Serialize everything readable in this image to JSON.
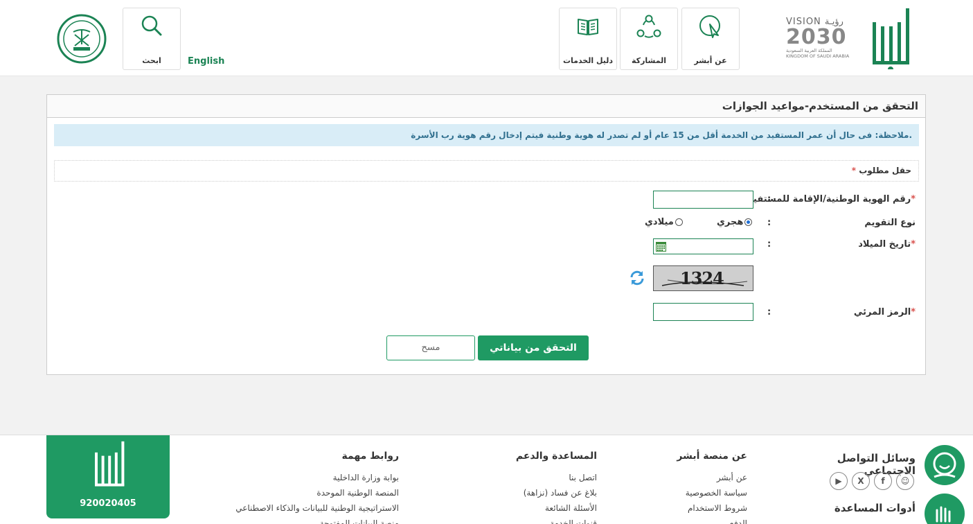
{
  "header": {
    "vision_text": "VISION",
    "vision_arabic": "رؤيـة",
    "vision_year": "2030",
    "kingdom_ar": "المملكة العربية السعودية",
    "kingdom_en": "KINGDOM OF SAUDI ARABIA",
    "tiles": [
      {
        "label": "عن أبشر",
        "icon": "cursor-icon"
      },
      {
        "label": "المشاركة",
        "icon": "share-icon"
      },
      {
        "label": "دليل الخدمات",
        "icon": "book-icon"
      }
    ],
    "search_label": "ابحث",
    "language_link": "English",
    "accent": "#1b8354"
  },
  "form": {
    "title": "التحقق من المستخدم-مواعيد الجوازات",
    "note": "ملاحظة: فى حال أن عمر المستفيد من الخدمة أقل من 15 عام أو لم تصدر له هوية وطنية فيتم إدخال رقم هوية رب الأسرة.",
    "required_note": "حقل مطلوب",
    "id_label": "رقم الهوية الوطنية/الإقامة للمستفيد",
    "calendar_label": "نوع التقويم",
    "hijri": "هجري",
    "gregorian": "ميلادي",
    "birth_label": "تاريخ الميلاد",
    "captcha_text": "1324",
    "visual_code_label": "الرمز المرئي",
    "colon": ":",
    "star": "*",
    "verify_button": "التحقق من بياناتي",
    "clear_button": "مسح"
  },
  "footer": {
    "social_title": "وسائل التواصل الاجتماعي",
    "tools_title": "أدوات المساعدة",
    "about": {
      "title": "عن منصة أبشر",
      "links": [
        "عن أبشر",
        "سياسة الخصوصية",
        "شروط الاستخدام",
        "الدفع"
      ]
    },
    "help": {
      "title": "المساعدة والدعم",
      "links": [
        "اتصل بنا",
        "بلاغ عن فساد (نزاهة)",
        "الأسئلة الشائعة",
        "قنوات الخدمة"
      ]
    },
    "links": {
      "title": "روابط مهمة",
      "links": [
        "بوابة وزارة الداخلية",
        "المنصة الوطنية الموحدة",
        "الاستراتيجية الوطنية للبيانات والذكاء الاصطناعي",
        "منصة البيانات المفتوحة"
      ]
    },
    "phone": "920020405"
  }
}
